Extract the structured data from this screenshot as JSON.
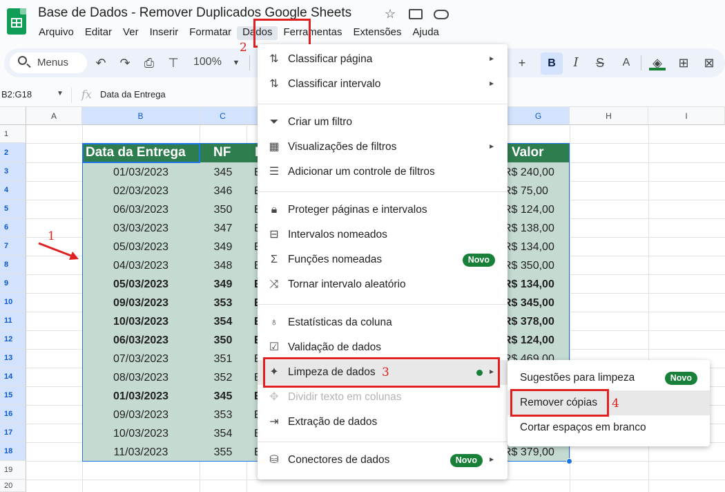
{
  "doc": {
    "title": "Base de Dados - Remover Duplicados Google Sheets",
    "icons": [
      "star-icon",
      "move-to-folder-icon",
      "cloud-status-icon"
    ]
  },
  "menubar": [
    "Arquivo",
    "Editar",
    "Ver",
    "Inserir",
    "Formatar",
    "Dados",
    "Ferramentas",
    "Extensões",
    "Ajuda"
  ],
  "toolbar": {
    "search_label": "Menus",
    "zoom": "100%",
    "bold": "B",
    "italic": "I",
    "strike": "S",
    "text_color": "A",
    "plus": "+"
  },
  "formula_bar": {
    "name_box": "B2:G18",
    "fx": "fx",
    "value": "Data da Entrega"
  },
  "columns": [
    "A",
    "B",
    "C",
    "",
    "G",
    "H",
    "I"
  ],
  "rows": [
    "1",
    "2",
    "3",
    "4",
    "5",
    "6",
    "7",
    "8",
    "9",
    "10",
    "11",
    "12",
    "13",
    "14",
    "15",
    "16",
    "17",
    "18",
    "19",
    "20"
  ],
  "table": {
    "headers": {
      "date": "Data da Entrega",
      "nf": "NF",
      "third": "D",
      "value": "Valor"
    },
    "rows": [
      {
        "date": "01/03/2023",
        "nf": "345",
        "third": "E",
        "value": "R$ 240,00",
        "bold": false
      },
      {
        "date": "02/03/2023",
        "nf": "346",
        "third": "E",
        "value": "R$ 75,00",
        "bold": false
      },
      {
        "date": "06/03/2023",
        "nf": "350",
        "third": "E",
        "value": "R$ 124,00",
        "bold": false
      },
      {
        "date": "03/03/2023",
        "nf": "347",
        "third": "E",
        "value": "R$ 138,00",
        "bold": false
      },
      {
        "date": "05/03/2023",
        "nf": "349",
        "third": "E",
        "value": "R$ 134,00",
        "bold": false
      },
      {
        "date": "04/03/2023",
        "nf": "348",
        "third": "E",
        "value": "R$ 350,00",
        "bold": false
      },
      {
        "date": "05/03/2023",
        "nf": "349",
        "third": "E",
        "value": "R$ 134,00",
        "bold": true
      },
      {
        "date": "09/03/2023",
        "nf": "353",
        "third": "E",
        "value": "R$ 345,00",
        "bold": true
      },
      {
        "date": "10/03/2023",
        "nf": "354",
        "third": "E",
        "value": "R$ 378,00",
        "bold": true
      },
      {
        "date": "06/03/2023",
        "nf": "350",
        "third": "E",
        "value": "R$ 124,00",
        "bold": true
      },
      {
        "date": "07/03/2023",
        "nf": "351",
        "third": "E",
        "value": "R$ 469,00",
        "bold": false
      },
      {
        "date": "08/03/2023",
        "nf": "352",
        "third": "E",
        "value": "",
        "bold": false
      },
      {
        "date": "01/03/2023",
        "nf": "345",
        "third": "E",
        "value": "",
        "bold": true
      },
      {
        "date": "09/03/2023",
        "nf": "353",
        "third": "E",
        "value": "",
        "bold": false
      },
      {
        "date": "10/03/2023",
        "nf": "354",
        "third": "E",
        "value": "",
        "bold": false
      },
      {
        "date": "11/03/2023",
        "nf": "355",
        "third": "E",
        "value": "R$ 379,00",
        "bold": false
      }
    ]
  },
  "dados_menu": {
    "items": [
      {
        "label": "Classificar página",
        "icon": "sort-icon",
        "arrow": true
      },
      {
        "label": "Classificar intervalo",
        "icon": "sort-range-icon",
        "arrow": true
      },
      {
        "label": "Criar um filtro",
        "icon": "filter-icon"
      },
      {
        "label": "Visualizações de filtros",
        "icon": "filter-views-icon",
        "arrow": true
      },
      {
        "label": "Adicionar um controle de filtros",
        "icon": "slicer-icon"
      },
      {
        "label": "Proteger páginas e intervalos",
        "icon": "lock-icon"
      },
      {
        "label": "Intervalos nomeados",
        "icon": "named-ranges-icon"
      },
      {
        "label": "Funções nomeadas",
        "icon": "sigma-icon",
        "badge": "Novo"
      },
      {
        "label": "Tornar intervalo aleatório",
        "icon": "shuffle-icon"
      },
      {
        "label": "Estatísticas da coluna",
        "icon": "lightbulb-icon"
      },
      {
        "label": "Validação de dados",
        "icon": "data-validation-icon"
      },
      {
        "label": "Limpeza de dados",
        "icon": "magic-wand-icon",
        "arrow": true
      },
      {
        "label": "Dividir texto em colunas",
        "icon": "split-icon",
        "disabled": true
      },
      {
        "label": "Extração de dados",
        "icon": "extract-icon"
      },
      {
        "label": "Conectores de dados",
        "icon": "database-icon",
        "badge": "Novo",
        "arrow": true
      }
    ]
  },
  "cleanup_submenu": {
    "items": [
      {
        "label": "Sugestões para limpeza",
        "badge": "Novo"
      },
      {
        "label": "Remover cópias"
      },
      {
        "label": "Cortar espaços em branco"
      }
    ]
  },
  "annotations": [
    "1",
    "2",
    "3",
    "4"
  ],
  "colors": {
    "accent": "#1a73e8",
    "header_green": "#2e7d4f",
    "table_fill": "#c5dbd2",
    "badge": "#188038",
    "annotation_red": "#e02020"
  }
}
